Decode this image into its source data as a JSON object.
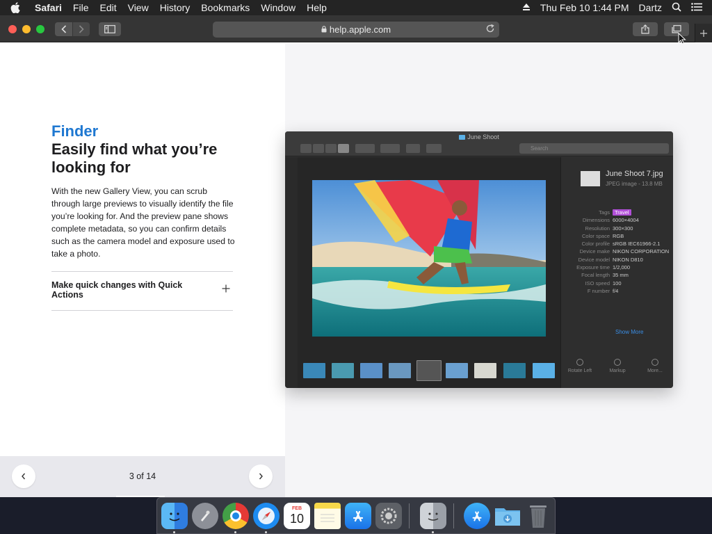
{
  "menubar": {
    "app_name": "Safari",
    "menus": [
      "File",
      "Edit",
      "View",
      "History",
      "Bookmarks",
      "Window",
      "Help"
    ],
    "clock": "Thu Feb 10  1:44 PM",
    "user": "Dartz"
  },
  "browser": {
    "url": "help.apple.com"
  },
  "page": {
    "eyebrow": "Finder",
    "headline": "Easily find what you’re looking for",
    "body": "With the new Gallery View, you can scrub through large previews to visually identify the file you’re looking for. And the preview pane shows complete metadata, so you can confirm details such as the camera model and exposure used to take a photo.",
    "accordion": {
      "title": "Make quick changes with Quick Actions",
      "expanded": false
    },
    "pager": {
      "label": "3 of 14",
      "progress": 0.214
    }
  },
  "finder": {
    "window_title": "June Shoot",
    "search_placeholder": "Search",
    "file_name": "June Shoot 7.jpg",
    "file_sub": "JPEG image - 13.8 MB",
    "metadata": [
      {
        "key": "Tags",
        "value": "Travel",
        "tag": true
      },
      {
        "key": "Dimensions",
        "value": "6000×4004"
      },
      {
        "key": "Resolution",
        "value": "300×300"
      },
      {
        "key": "Color space",
        "value": "RGB"
      },
      {
        "key": "Color profile",
        "value": "sRGB IEC61966-2.1"
      },
      {
        "key": "Device make",
        "value": "NIKON CORPORATION"
      },
      {
        "key": "Device model",
        "value": "NIKON D810"
      },
      {
        "key": "Exposure time",
        "value": "1/2,000"
      },
      {
        "key": "Focal length",
        "value": "35 mm"
      },
      {
        "key": "ISO speed",
        "value": "100"
      },
      {
        "key": "F number",
        "value": "f/4"
      }
    ],
    "show_more": "Show More",
    "quick_actions": [
      "Rotate Left",
      "Markup",
      "More..."
    ]
  },
  "dock": {
    "apps": [
      "Finder",
      "Launchpad",
      "Google Chrome",
      "Safari",
      "Calendar",
      "Notes",
      "App Store",
      "System Preferences",
      "Finder (alt)",
      "Applications",
      "Downloads",
      "Trash"
    ],
    "calendar_month": "FEB",
    "calendar_day": "10"
  },
  "colors": {
    "accent_link": "#1f78d1",
    "tag_travel": "#b14fd8"
  }
}
